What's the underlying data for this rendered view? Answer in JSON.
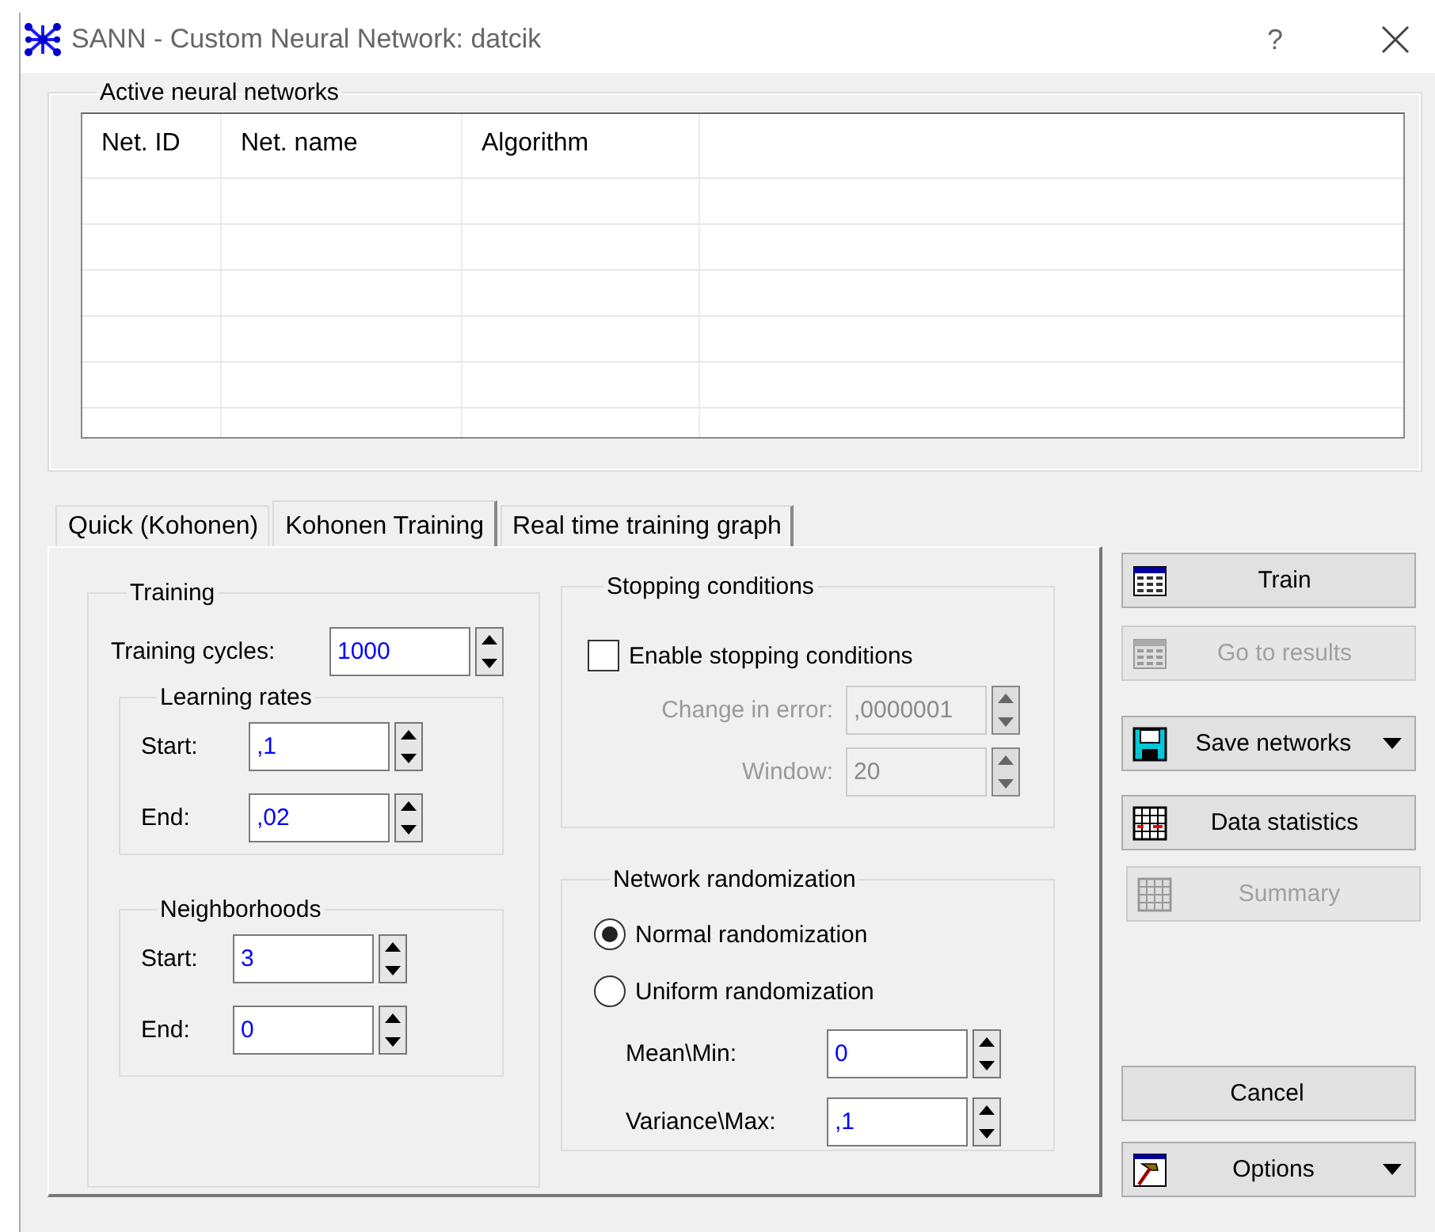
{
  "window": {
    "title": "SANN - Custom Neural Network: datcik",
    "help": "?"
  },
  "networks": {
    "title": "Active neural networks",
    "columns": [
      "Net. ID",
      "Net. name",
      "Algorithm"
    ]
  },
  "tabs": [
    {
      "label": "Quick (Kohonen)",
      "selected": false
    },
    {
      "label": "Kohonen Training",
      "selected": true
    },
    {
      "label": "Real time training graph",
      "selected": false
    }
  ],
  "training": {
    "title": "Training",
    "cycles": {
      "label": "Training cycles:",
      "value": "1000"
    },
    "groups": [
      {
        "title": "Learning rates",
        "fields": [
          {
            "label": "Start:",
            "value": ",1"
          },
          {
            "label": "End:",
            "value": ",02"
          }
        ]
      },
      {
        "title": "Neighborhoods",
        "fields": [
          {
            "label": "Start:",
            "value": "3"
          },
          {
            "label": "End:",
            "value": "0"
          }
        ]
      }
    ]
  },
  "stopping": {
    "title": "Stopping conditions",
    "enable": {
      "label": "Enable stopping conditions",
      "checked": false
    },
    "fields": [
      {
        "label": "Change in error:",
        "value": ",0000001",
        "disabled": true
      },
      {
        "label": "Window:",
        "value": "20",
        "disabled": true
      }
    ]
  },
  "randomization": {
    "title": "Network randomization",
    "options": [
      {
        "label": "Normal randomization",
        "selected": true
      },
      {
        "label": "Uniform randomization",
        "selected": false
      }
    ],
    "fields": [
      {
        "label": "Mean\\Min:",
        "value": "0"
      },
      {
        "label": "Variance\\Max:",
        "value": ",1"
      }
    ]
  },
  "actions": [
    {
      "label": "Train",
      "kind": "train",
      "disabled": false,
      "dropdown": false
    },
    {
      "label": "Go to results",
      "kind": "results",
      "disabled": true,
      "dropdown": false
    },
    {
      "label": "Save networks",
      "kind": "save",
      "disabled": false,
      "dropdown": true
    },
    {
      "label": "Data statistics",
      "kind": "stats",
      "disabled": false,
      "dropdown": false
    },
    {
      "label": "Summary",
      "kind": "summary",
      "disabled": true,
      "dropdown": false
    }
  ],
  "footer_actions": [
    {
      "label": "Cancel",
      "kind": "plain",
      "disabled": false,
      "dropdown": false
    },
    {
      "label": "Options",
      "kind": "options",
      "disabled": false,
      "dropdown": true
    }
  ]
}
